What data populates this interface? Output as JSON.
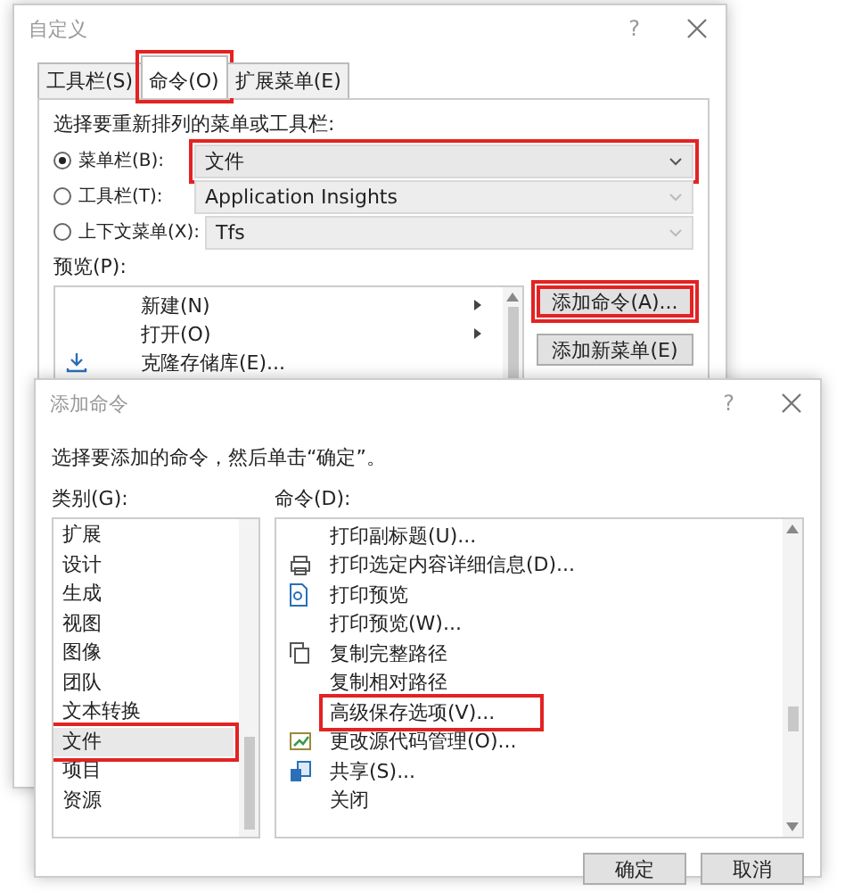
{
  "back_dialog": {
    "title": "自定义",
    "help": "?",
    "tabs": [
      {
        "label": "工具栏(S)",
        "selected": false,
        "annotated": false
      },
      {
        "label": "命令(O)",
        "selected": true,
        "annotated": true
      },
      {
        "label": "扩展菜单(E)",
        "selected": false,
        "annotated": false
      }
    ],
    "prompt": "选择要重新排列的菜单或工具栏:",
    "targets": [
      {
        "label": "菜单栏(B):",
        "value": "文件",
        "selected": true,
        "disabled": false,
        "annotated": true
      },
      {
        "label": "工具栏(T):",
        "value": "Application Insights",
        "selected": false,
        "disabled": true,
        "annotated": false
      },
      {
        "label": "上下文菜单(X):",
        "value": "Tfs",
        "selected": false,
        "disabled": true,
        "annotated": false
      }
    ],
    "preview_label": "预览(P):",
    "preview_items": [
      {
        "label": "新建(N)",
        "submenu": true,
        "kind": "plain"
      },
      {
        "label": "打开(O)",
        "submenu": true,
        "kind": "plain"
      },
      {
        "label": "克隆存储库(E)...",
        "submenu": false,
        "kind": "download"
      }
    ],
    "buttons": [
      {
        "label": "添加命令(A)...",
        "annotated": true
      },
      {
        "label": "添加新菜单(E)",
        "annotated": false
      }
    ]
  },
  "front_dialog": {
    "title": "添加命令",
    "help": "?",
    "instruction": "选择要添加的命令，然后单击“确定”。",
    "categories_label": "类别(G):",
    "commands_label": "命令(D):",
    "categories": [
      {
        "label": "扩展",
        "selected": false,
        "annotated": false
      },
      {
        "label": "设计",
        "selected": false,
        "annotated": false
      },
      {
        "label": "生成",
        "selected": false,
        "annotated": false
      },
      {
        "label": "视图",
        "selected": false,
        "annotated": false
      },
      {
        "label": "图像",
        "selected": false,
        "annotated": false
      },
      {
        "label": "团队",
        "selected": false,
        "annotated": false
      },
      {
        "label": "文本转换",
        "selected": false,
        "annotated": false
      },
      {
        "label": "文件",
        "selected": true,
        "annotated": true
      },
      {
        "label": "项目",
        "selected": false,
        "annotated": false
      },
      {
        "label": "资源",
        "selected": false,
        "annotated": false
      }
    ],
    "commands": [
      {
        "label": "打印副标题(U)...",
        "kind": "plain",
        "annotated": false
      },
      {
        "label": "打印选定内容详细信息(D)...",
        "kind": "printer",
        "annotated": false
      },
      {
        "label": "打印预览",
        "kind": "preview",
        "annotated": false
      },
      {
        "label": "打印预览(W)...",
        "kind": "plain",
        "annotated": false
      },
      {
        "label": "复制完整路径",
        "kind": "copy",
        "annotated": false
      },
      {
        "label": "复制相对路径",
        "kind": "plain",
        "annotated": false
      },
      {
        "label": "高级保存选项(V)...",
        "kind": "plain",
        "annotated": true
      },
      {
        "label": "更改源代码管理(O)...",
        "kind": "source-control",
        "annotated": false
      },
      {
        "label": "共享(S)...",
        "kind": "share",
        "annotated": false
      },
      {
        "label": "关闭",
        "kind": "plain",
        "annotated": false
      }
    ],
    "buttons": [
      {
        "label": "确定"
      },
      {
        "label": "取消"
      }
    ]
  }
}
